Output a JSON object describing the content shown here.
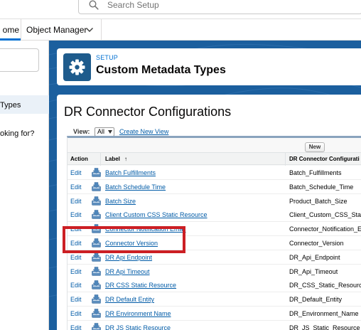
{
  "search": {
    "placeholder": "Search Setup"
  },
  "nav": {
    "home_tab": "ome",
    "object_manager_tab": "Object Manager"
  },
  "left_nav": {
    "selected_item": "Types",
    "looking_for": "oking for?"
  },
  "setup_header": {
    "eyebrow": "SETUP",
    "title": "Custom Metadata Types"
  },
  "page": {
    "title": "DR Connector Configurations",
    "view_label": "View:",
    "view_value": "All",
    "create_view_link": "Create New View",
    "new_button": "New"
  },
  "table": {
    "columns": {
      "action": "Action",
      "label": "Label",
      "sort_indicator": "↑",
      "developer_name": "DR Connector Configurati"
    },
    "rows": [
      {
        "edit": "Edit",
        "label": "Batch Fulfillments",
        "developer_name": "Batch_Fulfillments"
      },
      {
        "edit": "Edit",
        "label": "Batch Schedule Time",
        "developer_name": "Batch_Schedule_Time"
      },
      {
        "edit": "Edit",
        "label": "Batch Size",
        "developer_name": "Product_Batch_Size"
      },
      {
        "edit": "Edit",
        "label": "Client Custom CSS Static Resource",
        "developer_name": "Client_Custom_CSS_Sta"
      },
      {
        "edit": "Edit",
        "label": "Connector Notification Email",
        "developer_name": "Connector_Notification_E"
      },
      {
        "edit": "Edit",
        "label": "Connector Version",
        "developer_name": "Connector_Version"
      },
      {
        "edit": "Edit",
        "label": "DR Api Endpoint",
        "developer_name": "DR_Api_Endpoint"
      },
      {
        "edit": "Edit",
        "label": "DR Api Timeout",
        "developer_name": "DR_Api_Timeout"
      },
      {
        "edit": "Edit",
        "label": "DR CSS Static Resource",
        "developer_name": "DR_CSS_Static_Resource"
      },
      {
        "edit": "Edit",
        "label": "DR Default Entity",
        "developer_name": "DR_Default_Entity"
      },
      {
        "edit": "Edit",
        "label": "DR Environment Name",
        "developer_name": "DR_Environment_Name"
      },
      {
        "edit": "Edit",
        "label": "DR JS Static Resource",
        "developer_name": "DR_JS_Static_Resource"
      }
    ]
  },
  "icons": {
    "search": "search-icon",
    "chevron": "chevron-down-icon",
    "setup": "gear-icon",
    "row": "download-tray-icon"
  },
  "colors": {
    "brand_blue": "#1b5f9e",
    "link": "#015ba7",
    "highlight": "#cc1f24",
    "setup_icon": "#1e5b8c"
  }
}
